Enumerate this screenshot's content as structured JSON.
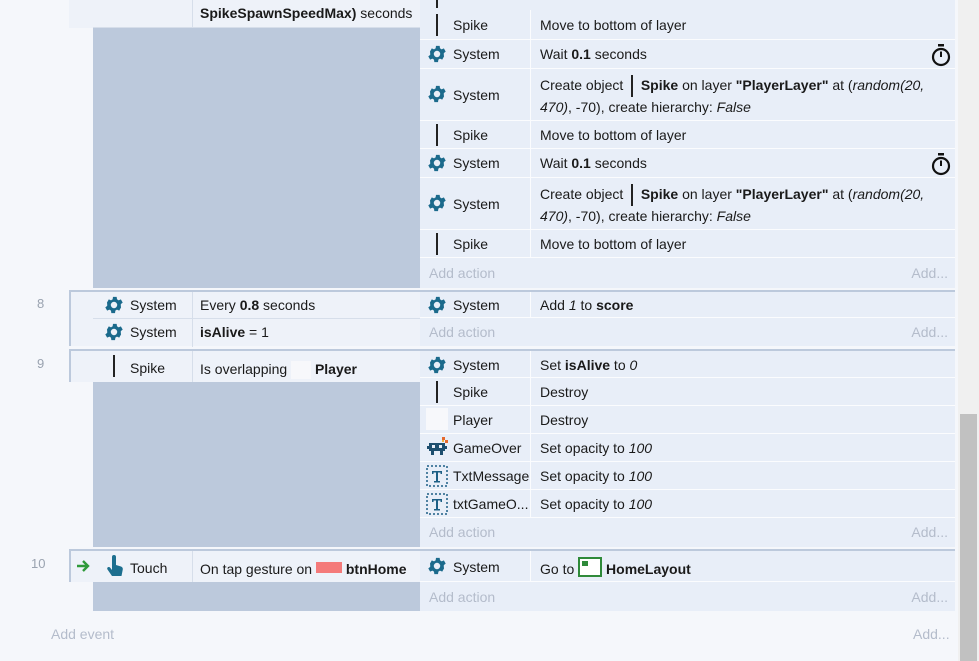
{
  "event7": {
    "cond_text_bold": "SpikeSpawnSpeedMax)",
    "cond_text_rest": " seconds",
    "actions": [
      {
        "object": "Spike",
        "text": "Move to bottom of layer"
      },
      {
        "object": "System",
        "pre": "Wait ",
        "bold": "0.1",
        "post": " seconds"
      },
      {
        "object": "System",
        "line1_pre": "Create object",
        "obj": "Spike",
        "on_layer": " on layer ",
        "layer": "\"PlayerLayer\"",
        "at": " at (",
        "rand": "random(20,",
        "line2_rand": "470)",
        "line2_mid": ", -70), create hierarchy: ",
        "line2_val": "False"
      },
      {
        "object": "Spike",
        "text": "Move to bottom of layer"
      },
      {
        "object": "System",
        "pre": "Wait ",
        "bold": "0.1",
        "post": " seconds"
      },
      {
        "object": "System",
        "line1_pre": "Create object",
        "obj": "Spike",
        "on_layer": " on layer ",
        "layer": "\"PlayerLayer\"",
        "at": " at (",
        "rand": "random(20,",
        "line2_rand": "470)",
        "line2_mid": ", -70), create hierarchy: ",
        "line2_val": "False"
      },
      {
        "object": "Spike",
        "text": "Move to bottom of layer"
      }
    ],
    "add_action": "Add action",
    "add_short": "Add..."
  },
  "event8": {
    "number": "8",
    "conditions": [
      {
        "object": "System",
        "pre": "Every ",
        "bold": "0.8",
        "post": " seconds"
      },
      {
        "object": "System",
        "bold": "isAlive",
        "post": " = 1"
      }
    ],
    "action": {
      "object": "System",
      "pre": "Add ",
      "ital": "1",
      "mid": " to ",
      "bold": "score"
    },
    "add_action": "Add action",
    "add_short": "Add..."
  },
  "event9": {
    "number": "9",
    "condition": {
      "object": "Spike",
      "pre": "Is overlapping",
      "bold": "Player"
    },
    "actions": [
      {
        "object": "System",
        "pre": "Set ",
        "bold": "isAlive",
        "mid": " to ",
        "ital": "0"
      },
      {
        "object": "Spike",
        "text": "Destroy"
      },
      {
        "object": "Player",
        "text": "Destroy"
      },
      {
        "object": "GameOver",
        "pre": "Set opacity to ",
        "ital": "100"
      },
      {
        "object": "TxtMessage",
        "pre": "Set opacity to ",
        "ital": "100"
      },
      {
        "object": "txtGameO...",
        "pre": "Set opacity to ",
        "ital": "100"
      }
    ],
    "add_action": "Add action",
    "add_short": "Add..."
  },
  "event10": {
    "number": "10",
    "condition": {
      "object": "Touch",
      "pre": "On tap gesture on",
      "bold": "btnHome"
    },
    "action": {
      "object": "System",
      "pre": "Go to",
      "bold": "HomeLayout"
    },
    "add_action": "Add action",
    "add_short": "Add..."
  },
  "footer": {
    "add_event": "Add event",
    "add_short": "Add..."
  },
  "colors": {
    "accent": "#1b6a8c",
    "block": "#bcc9dc",
    "action_bg": "#e8eef8",
    "swatch": "#f47a7a"
  },
  "icons": [
    "gear-icon",
    "stopwatch-icon",
    "touch-icon",
    "arrow-right-icon",
    "invader-icon",
    "text-t-icon",
    "layout-icon"
  ]
}
